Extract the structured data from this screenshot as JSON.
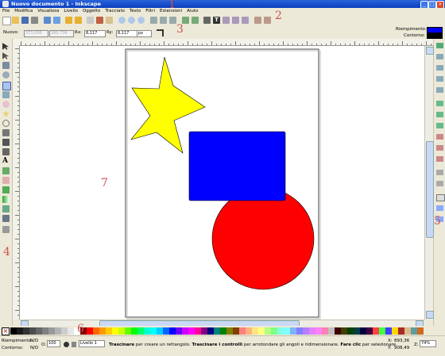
{
  "window": {
    "title": "Nuovo documento 1 - Inkscape"
  },
  "menu": [
    "File",
    "Modifica",
    "Visualizza",
    "Livello",
    "Oggetto",
    "Tracciato",
    "Testo",
    "Filtri",
    "Estensioni",
    "Aiuto"
  ],
  "control_bar": {
    "tool_label": "Nuovo:",
    "w_value": "373,000",
    "h_value": "260,736",
    "rx_label": "Rx:",
    "rx_value": "8,117",
    "ry_label": "Ry:",
    "ry_value": "8,117",
    "unit": "px"
  },
  "style_indicator": {
    "fill_label": "Riempimento:",
    "stroke_label": "Contorno:",
    "fill_color": "#0000ff",
    "stroke_color": "#000000"
  },
  "status": {
    "fill_label": "Riempimento:",
    "fill_value": "N/D",
    "stroke_label": "Contorno:",
    "stroke_value": "N/D",
    "opacity_label": "O:",
    "opacity_value": "100",
    "layer_value": "Livello 1",
    "message_bold1": "Trascinare",
    "message_text1": " per creare un rettangolo. ",
    "message_bold2": "Trascinare i controlli",
    "message_text2": " per arrotondare gli angoli e ridimensionare. ",
    "message_bold3": "Fare clic",
    "message_text3": " per selezionare.",
    "x_label": "X:",
    "x_value": "893,36",
    "y_label": "Y:",
    "y_value": "908,49",
    "zoom_label": "Z:",
    "zoom_value": "74%"
  },
  "annotations": [
    "1",
    "2",
    "3",
    "4",
    "5",
    "6",
    "7"
  ],
  "shapes": {
    "star_fill": "#ffff00",
    "rect_fill": "#0000ff",
    "circle_fill": "#ff0000"
  },
  "palette_colors": [
    "#000000",
    "#1a1a1a",
    "#333333",
    "#4d4d4d",
    "#666666",
    "#808080",
    "#999999",
    "#b3b3b3",
    "#cccccc",
    "#e6e6e6",
    "#ffffff",
    "#800000",
    "#ff0000",
    "#ff6600",
    "#ff9900",
    "#ffcc00",
    "#ffff00",
    "#ccff00",
    "#66ff00",
    "#00ff00",
    "#00ff66",
    "#00ffcc",
    "#00ffff",
    "#00ccff",
    "#0066ff",
    "#0000ff",
    "#6600ff",
    "#cc00ff",
    "#ff00ff",
    "#ff0099",
    "#800080",
    "#000080",
    "#008080",
    "#008000",
    "#808000",
    "#804000",
    "#ff8080",
    "#ffb380",
    "#ffe680",
    "#ffff80",
    "#b3ff80",
    "#80ff80",
    "#80ffe6",
    "#80ffff",
    "#80b3ff",
    "#8080ff",
    "#b380ff",
    "#e680ff",
    "#ff80ff",
    "#ff80b3",
    "#c0c0c0",
    "#400000",
    "#404000",
    "#004000",
    "#004040",
    "#000040",
    "#400040",
    "#ff4040",
    "#40ff40",
    "#4040ff",
    "#ffd700",
    "#a52a2a",
    "#deb887",
    "#5f9ea0",
    "#d2691e"
  ]
}
